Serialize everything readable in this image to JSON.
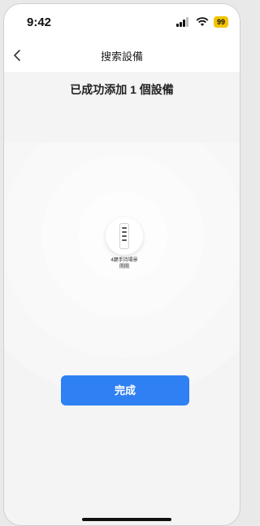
{
  "status": {
    "time": "9:42",
    "battery": "99"
  },
  "nav": {
    "title": "搜索設備",
    "back_icon": "chevron-left-icon"
  },
  "result": {
    "headline": "已成功添加 1 個設備"
  },
  "device": {
    "line1": "4鍵手持場景",
    "line2": "開關",
    "icon": "remote-control-icon"
  },
  "actions": {
    "done_label": "完成"
  },
  "colors": {
    "accent": "#2f80f2",
    "battery": "#f2c500"
  }
}
